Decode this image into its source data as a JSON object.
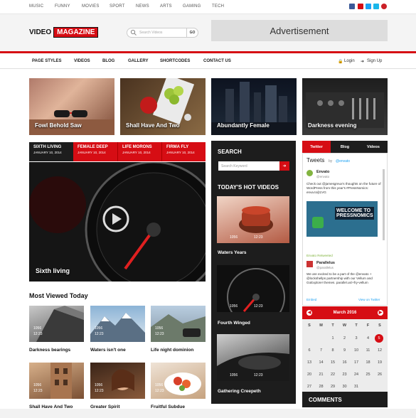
{
  "top_nav": [
    "MUSIC",
    "FUNNY",
    "MOVIES",
    "SPORT",
    "NEWS",
    "ARTS",
    "GAMING",
    "TECH"
  ],
  "social_icons": [
    {
      "name": "facebook-icon",
      "color": "#3b5998"
    },
    {
      "name": "youtube-icon",
      "color": "#d60d14"
    },
    {
      "name": "twitter-icon",
      "color": "#1da1f2"
    },
    {
      "name": "vimeo-icon",
      "color": "#1ab7ea"
    },
    {
      "name": "pinterest-icon",
      "color": "#cb2027"
    }
  ],
  "brand": {
    "video": "VIDEO",
    "magazine": "MAGAZINE",
    "accent": "#d60d14"
  },
  "search": {
    "placeholder": "Search Videos",
    "go": "GO"
  },
  "ad": {
    "label": "Advertisement"
  },
  "main_nav": [
    "PAGE STYLES",
    "VIDEOS",
    "BLOG",
    "GALLERY",
    "SHORTCODES",
    "CONTACT US"
  ],
  "account": {
    "login": "Login",
    "signup": "Sign Up"
  },
  "featured_tiles": [
    "Fowl Behold Saw",
    "Shall Have And Two",
    "Abundantly Female",
    "Darkness evening"
  ],
  "tabs": [
    {
      "title": "SIXTH LIVING",
      "date": "JANUARY 10, 2014"
    },
    {
      "title": "FEMALE DEEP",
      "date": "JANUARY 10, 2014"
    },
    {
      "title": "LIFE MORONS",
      "date": "JANUARY 10, 2014"
    },
    {
      "title": "FIRMA FLY",
      "date": "JANUARY 10, 2014"
    }
  ],
  "feature": {
    "caption": "Sixth living"
  },
  "most_viewed": {
    "heading": "Most Viewed Today",
    "items": [
      {
        "title": "Darkness bearings",
        "likes": "1056",
        "time": "12:23"
      },
      {
        "title": "Waters isn't one",
        "likes": "1056",
        "time": "12:23"
      },
      {
        "title": "Life night dominion",
        "likes": "1056",
        "time": "12:23"
      },
      {
        "title": "Shall Have And Two",
        "likes": "1056",
        "time": "12:23"
      },
      {
        "title": "Greater Spirit",
        "likes": "1056",
        "time": "12:23"
      },
      {
        "title": "Fruitful Subdue",
        "likes": "1056",
        "time": "12:23"
      }
    ]
  },
  "sidebar": {
    "search_heading": "SEARCH",
    "search_placeholder": "Search Keyword",
    "hot_heading": "TODAY'S HOT VIDEOS",
    "hot": [
      {
        "title": "Waters Years",
        "likes": "1056",
        "time": "12:23"
      },
      {
        "title": "Fourth Winged",
        "likes": "1056",
        "time": "12:23"
      },
      {
        "title": "Gathering Creepeth",
        "likes": "1056",
        "time": "12:23"
      }
    ]
  },
  "social_tabs": [
    "Twitter",
    "Blog",
    "Videos"
  ],
  "tweets": {
    "heading": "Tweets",
    "by": "by",
    "handle": "@envato",
    "t1_name": "Envato",
    "t1_handle": "@envato",
    "t1_text": "Check out @jamesgreux's thoughts on the future of WordPress from this year's #PressNomics: enva.to/jt1VG",
    "t1_image": "WELCOME TO PRESSNOMICS",
    "retweet": "Envato Retweeted",
    "t2_name": "Parallelus",
    "t2_handle": "@parallelus",
    "t2_text": "We are excited to be a part of the @envato + @lockshellps partnership with our Vellum and GoExplore! themes. parallel.us/+fry-vellum",
    "embed": "Embed",
    "view": "View on Twitter"
  },
  "calendar": {
    "month": "March 2016",
    "weekdays": [
      "S",
      "M",
      "T",
      "W",
      "T",
      "F",
      "S"
    ],
    "weeks": [
      [
        "",
        "",
        "1",
        "2",
        "3",
        "4",
        "5"
      ],
      [
        "6",
        "7",
        "8",
        "9",
        "10",
        "11",
        "12"
      ],
      [
        "13",
        "14",
        "15",
        "16",
        "17",
        "18",
        "19"
      ],
      [
        "20",
        "21",
        "22",
        "23",
        "24",
        "25",
        "26"
      ],
      [
        "27",
        "28",
        "29",
        "30",
        "31",
        "",
        ""
      ]
    ],
    "today": "5"
  },
  "comments": {
    "heading": "COMMENTS"
  }
}
